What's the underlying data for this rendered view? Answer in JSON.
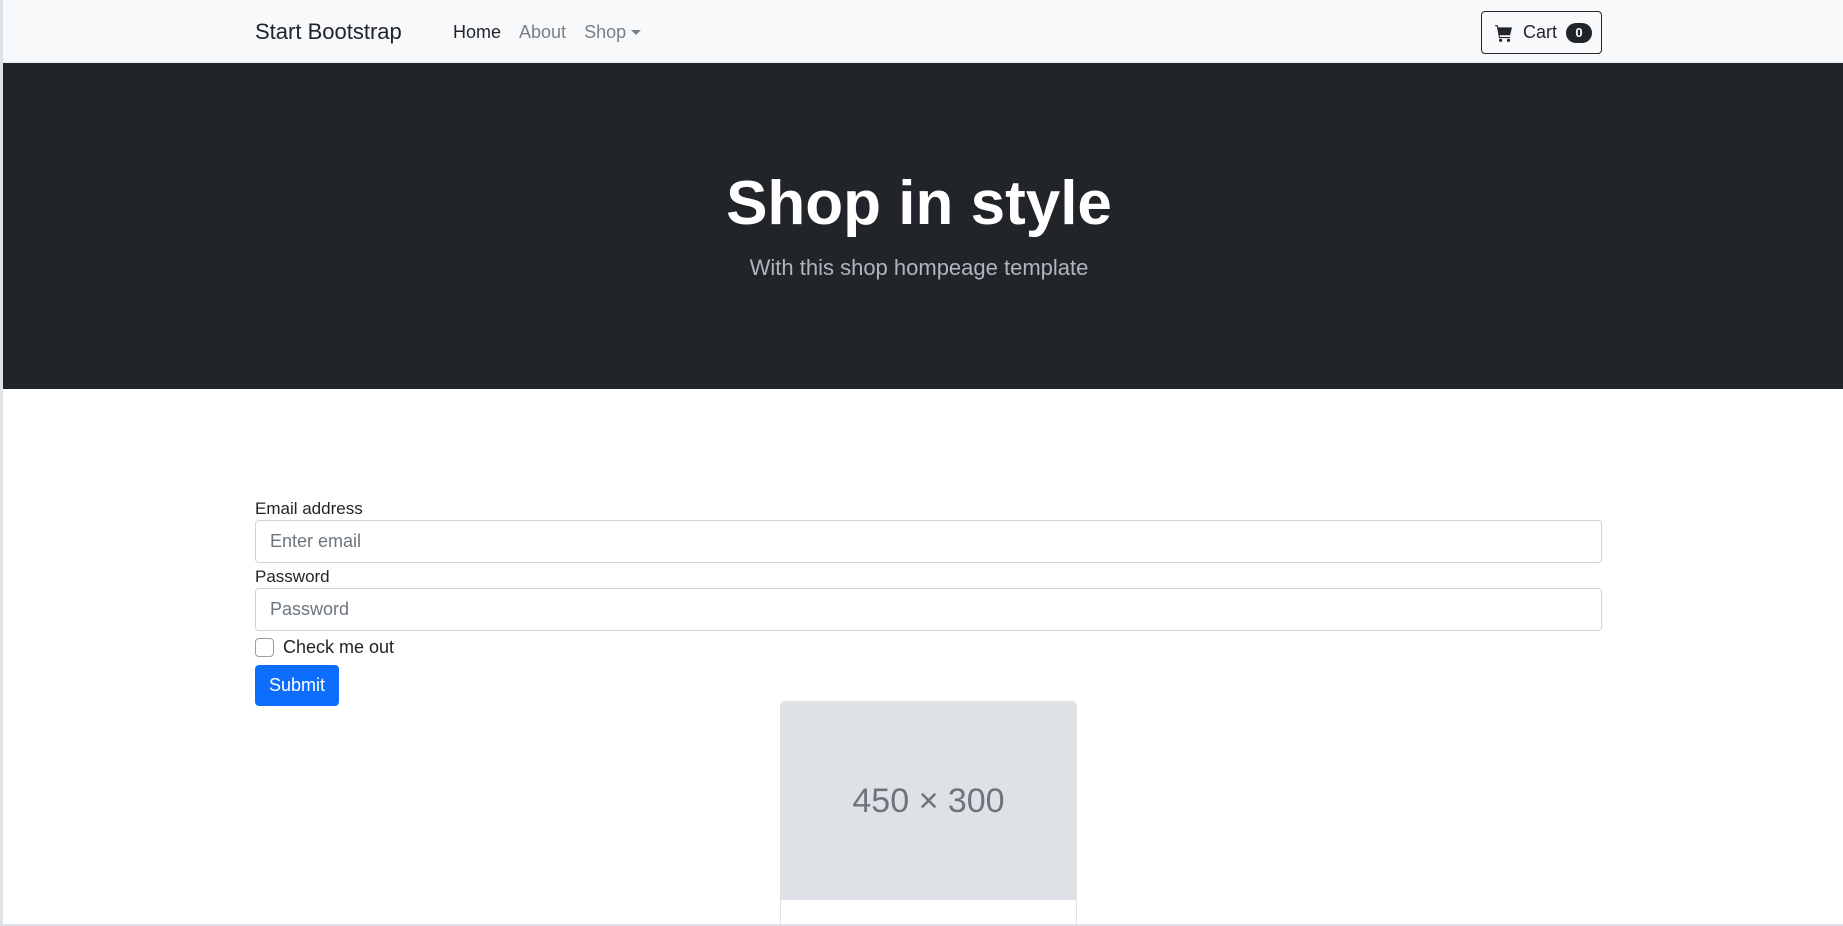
{
  "navbar": {
    "brand": "Start Bootstrap",
    "links": [
      {
        "label": "Home"
      },
      {
        "label": "About"
      },
      {
        "label": "Shop"
      }
    ],
    "cart": {
      "label": "Cart",
      "count": "0",
      "icon": "cart-icon"
    }
  },
  "hero": {
    "title": "Shop in style",
    "subtitle": "With this shop hompeage template"
  },
  "form": {
    "email_label": "Email address",
    "email_placeholder": "Enter email",
    "password_label": "Password",
    "password_placeholder": "Password",
    "check_label": "Check me out",
    "submit_label": "Submit"
  },
  "card": {
    "image_placeholder": "450 × 300"
  },
  "colors": {
    "primary": "#0d6efd",
    "dark": "#212529",
    "light": "#f8f9fa"
  }
}
